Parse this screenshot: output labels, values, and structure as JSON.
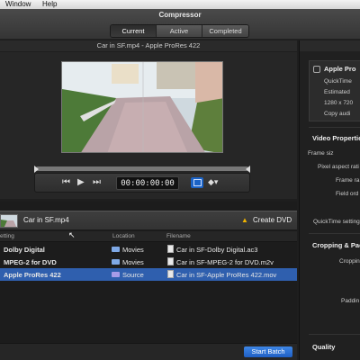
{
  "menu": {
    "items": [
      "Window",
      "Help"
    ]
  },
  "app": {
    "title": "Compressor"
  },
  "tabs": [
    "Current",
    "Active",
    "Completed"
  ],
  "preview": {
    "title": "Car in SF.mp4 - Apple ProRes 422",
    "timecode": "00:00:00:00"
  },
  "batch": {
    "job_name": "Car in SF.mp4",
    "create_dvd": "Create DVD",
    "columns": {
      "setting": "etting",
      "location": "Location",
      "filename": "Filename"
    },
    "rows": [
      {
        "setting": "Dolby Digital",
        "location": "Movies",
        "filename": "Car in SF-Dolby Digital.ac3"
      },
      {
        "setting": "MPEG-2 for DVD",
        "location": "Movies",
        "filename": "Car in SF-MPEG-2 for DVD.m2v"
      },
      {
        "setting": "Apple ProRes 422",
        "location": "Source",
        "filename": "Car in SF-Apple ProRes 422.mov"
      }
    ],
    "start_batch": "Start Batch"
  },
  "inspector": {
    "summary": {
      "title": "Apple Pro",
      "format": "QuickTime",
      "estimated": "Estimated",
      "resolution": "1280 x 720",
      "copy": "Copy audi"
    },
    "video_properties": "Video Propertie",
    "frame_size": "Frame siz",
    "pixel_aspect": "Pixel aspect rati",
    "frame_rate": "Frame ra",
    "field_order": "Field ord",
    "qt_settings": "QuickTime setting",
    "cropping": "Cropping & Pad",
    "crop_label": "Croppin",
    "padding_label": "Paddin",
    "quality": "Quality"
  }
}
